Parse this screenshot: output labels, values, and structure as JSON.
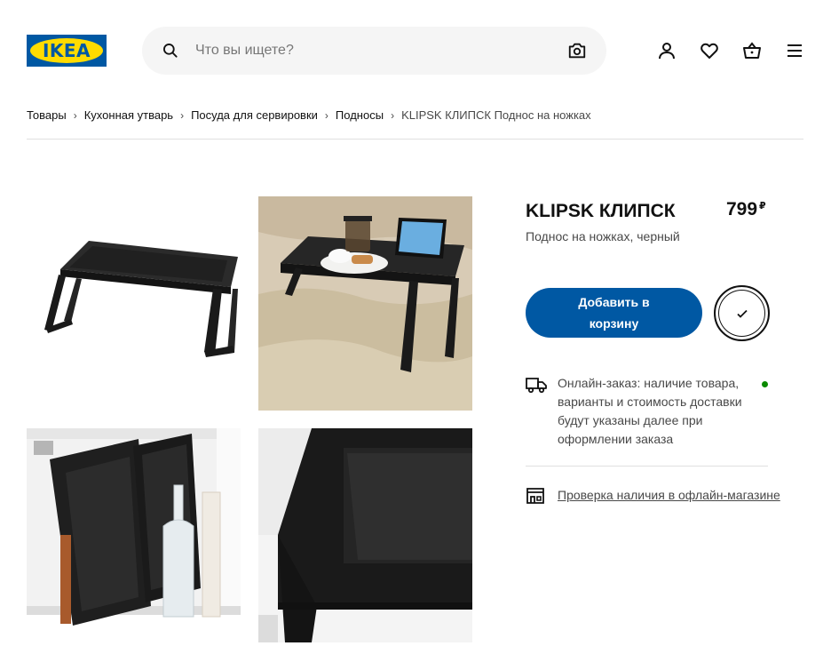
{
  "header": {
    "logo_text": "IKEA",
    "search": {
      "placeholder": "Что вы ищете?"
    },
    "icons": [
      "search-icon",
      "camera-icon",
      "user-icon",
      "heart-icon",
      "basket-icon",
      "menu-icon"
    ]
  },
  "breadcrumb": [
    {
      "label": "Товары"
    },
    {
      "label": "Кухонная утварь"
    },
    {
      "label": "Посуда для сервировки"
    },
    {
      "label": "Подносы"
    },
    {
      "label": "KLIPSK КЛИПСК Поднос на ножках"
    }
  ],
  "product": {
    "name": "KLIPSK КЛИПСК",
    "price": "799",
    "currency": "₽",
    "description": "Поднос на ножках, черный",
    "add_to_cart_label": "Добавить в корзину",
    "delivery_text": "Онлайн-заказ: наличие товара, варианты и стоимость доставки будут указаны далее при оформлении заказа",
    "store_check_label": "Проверка наличия в офлайн-магазине"
  },
  "colors": {
    "brand_blue": "#0058a3",
    "brand_yellow": "#ffdb00",
    "status_green": "#0a8a00"
  }
}
